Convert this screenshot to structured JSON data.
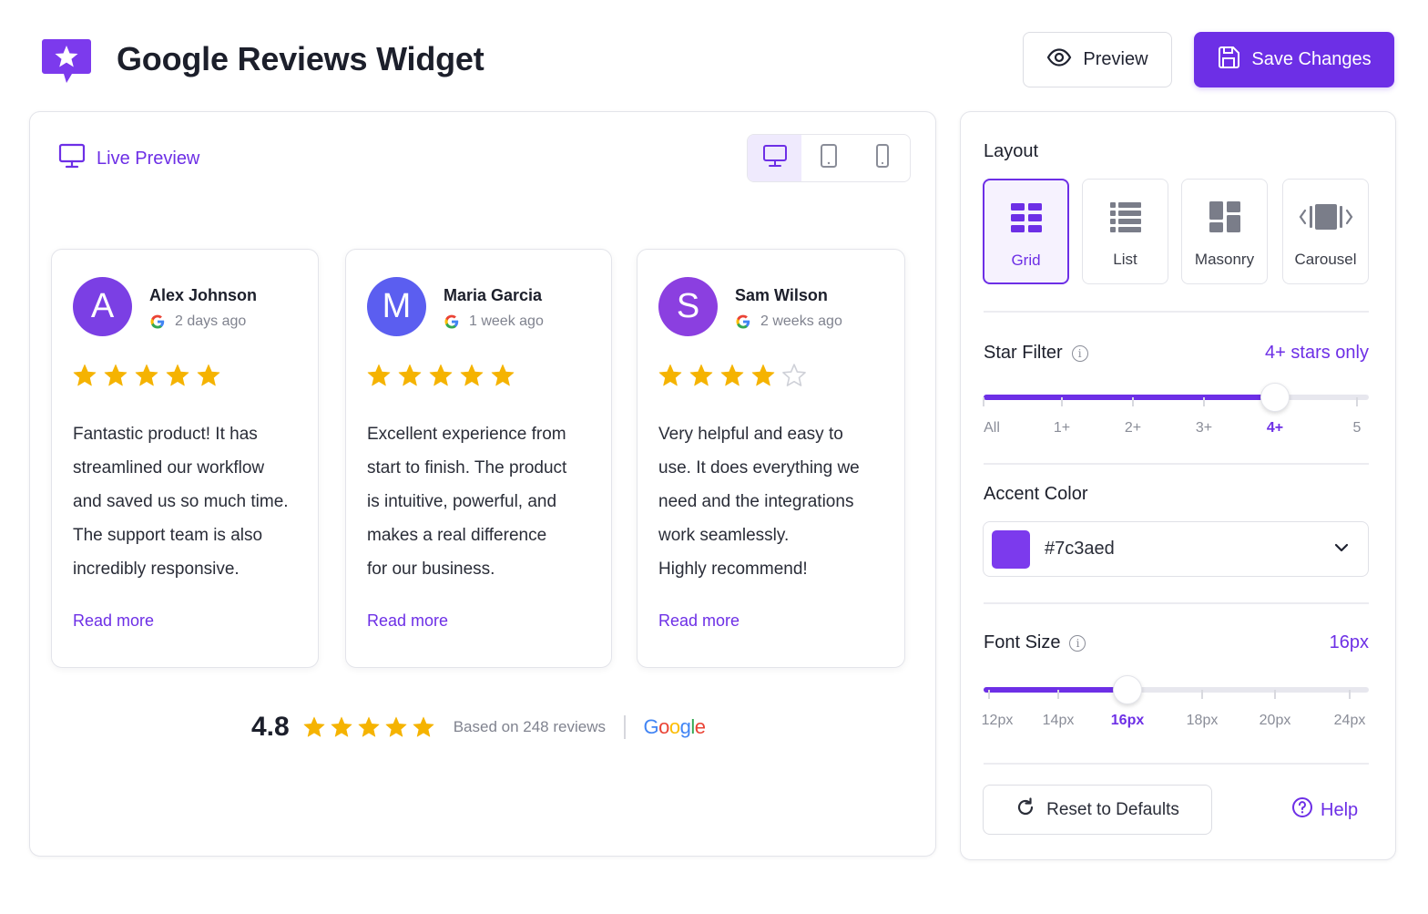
{
  "header": {
    "title": "Google Reviews Widget",
    "preview_label": "Preview",
    "save_label": "Save Changes"
  },
  "preview": {
    "label": "Live Preview",
    "devices": [
      "desktop",
      "tablet",
      "mobile"
    ],
    "active_device": "desktop",
    "reviews": [
      {
        "initial": "A",
        "name": "Alex Johnson",
        "time": "2 days ago",
        "rating": 5,
        "text_lines": [
          "Fantastic product! It has",
          "streamlined our workflow",
          "and saved us so much time.",
          "The support team is also",
          "incredibly responsive."
        ],
        "read_more": "Read more",
        "avatar_color": "#7b3fe4"
      },
      {
        "initial": "M",
        "name": "Maria Garcia",
        "time": "1 week ago",
        "rating": 5,
        "text_lines": [
          "Excellent experience from",
          "start to finish. The product",
          "is intuitive, powerful, and",
          "makes a real difference",
          "for our business."
        ],
        "read_more": "Read more",
        "avatar_color": "#5b5ef0"
      },
      {
        "initial": "S",
        "name": "Sam Wilson",
        "time": "2 weeks ago",
        "rating": 4,
        "text_lines": [
          "Very helpful and easy to",
          "use. It does everything we",
          "need and the integrations",
          "work seamlessly.",
          "Highly recommend!"
        ],
        "read_more": "Read more",
        "avatar_color": "#8b3fe0"
      }
    ],
    "summary": {
      "rating": "4.8",
      "stars": 5,
      "based_on": "Based on 248 reviews",
      "brand": "Google"
    }
  },
  "settings": {
    "layout": {
      "title": "Layout",
      "options": [
        {
          "label": "Grid",
          "icon": "grid-icon"
        },
        {
          "label": "List",
          "icon": "list-icon"
        },
        {
          "label": "Masonry",
          "icon": "masonry-icon"
        },
        {
          "label": "Carousel",
          "icon": "carousel-icon"
        }
      ],
      "selected": "Grid"
    },
    "star_filter": {
      "title": "Star Filter",
      "value_label": "4+ stars only",
      "ticks": [
        "All",
        "1+",
        "2+",
        "3+",
        "4+",
        "5"
      ],
      "selected_index": 4
    },
    "accent_color": {
      "title": "Accent Color",
      "value": "#7c3aed"
    },
    "font_size": {
      "title": "Font Size",
      "value_label": "16px",
      "ticks": [
        "12px",
        "14px",
        "16px",
        "18px",
        "20px",
        "24px"
      ],
      "selected_index": 2
    },
    "reset_label": "Reset to Defaults",
    "help_label": "Help"
  },
  "colors": {
    "brand": "#6d2fe6",
    "star": "#f5b301",
    "star_empty": "#cfd1d8"
  }
}
